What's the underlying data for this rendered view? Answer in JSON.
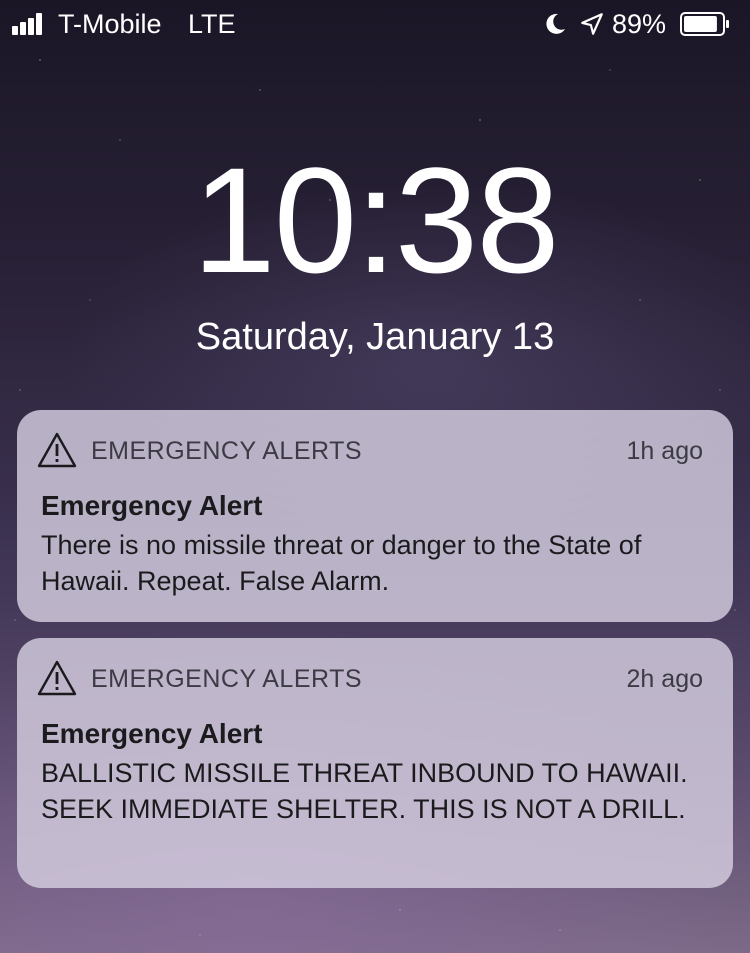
{
  "status_bar": {
    "carrier": "T-Mobile",
    "network": "LTE",
    "battery_percent": "89%",
    "signal_bars": 4,
    "battery_level": 0.89,
    "icons": [
      "signal-icon",
      "moon-icon",
      "location-icon",
      "battery-icon"
    ]
  },
  "lock_screen": {
    "time": "10:38",
    "date": "Saturday, January 13"
  },
  "notifications": [
    {
      "app": "EMERGENCY ALERTS",
      "time_ago": "1h ago",
      "title": "Emergency Alert",
      "body": "There is no missile threat or danger to the State of Hawaii. Repeat. False Alarm.",
      "icon": "alert-triangle-icon"
    },
    {
      "app": "EMERGENCY ALERTS",
      "time_ago": "2h ago",
      "title": "Emergency Alert",
      "body": "BALLISTIC MISSILE THREAT INBOUND TO HAWAII. SEEK IMMEDIATE SHELTER. THIS IS NOT A DRILL.",
      "icon": "alert-triangle-icon"
    }
  ],
  "colors": {
    "notification_bg": "#d6cee0",
    "text_dark": "#1b1b1e",
    "text_white": "#ffffff"
  }
}
